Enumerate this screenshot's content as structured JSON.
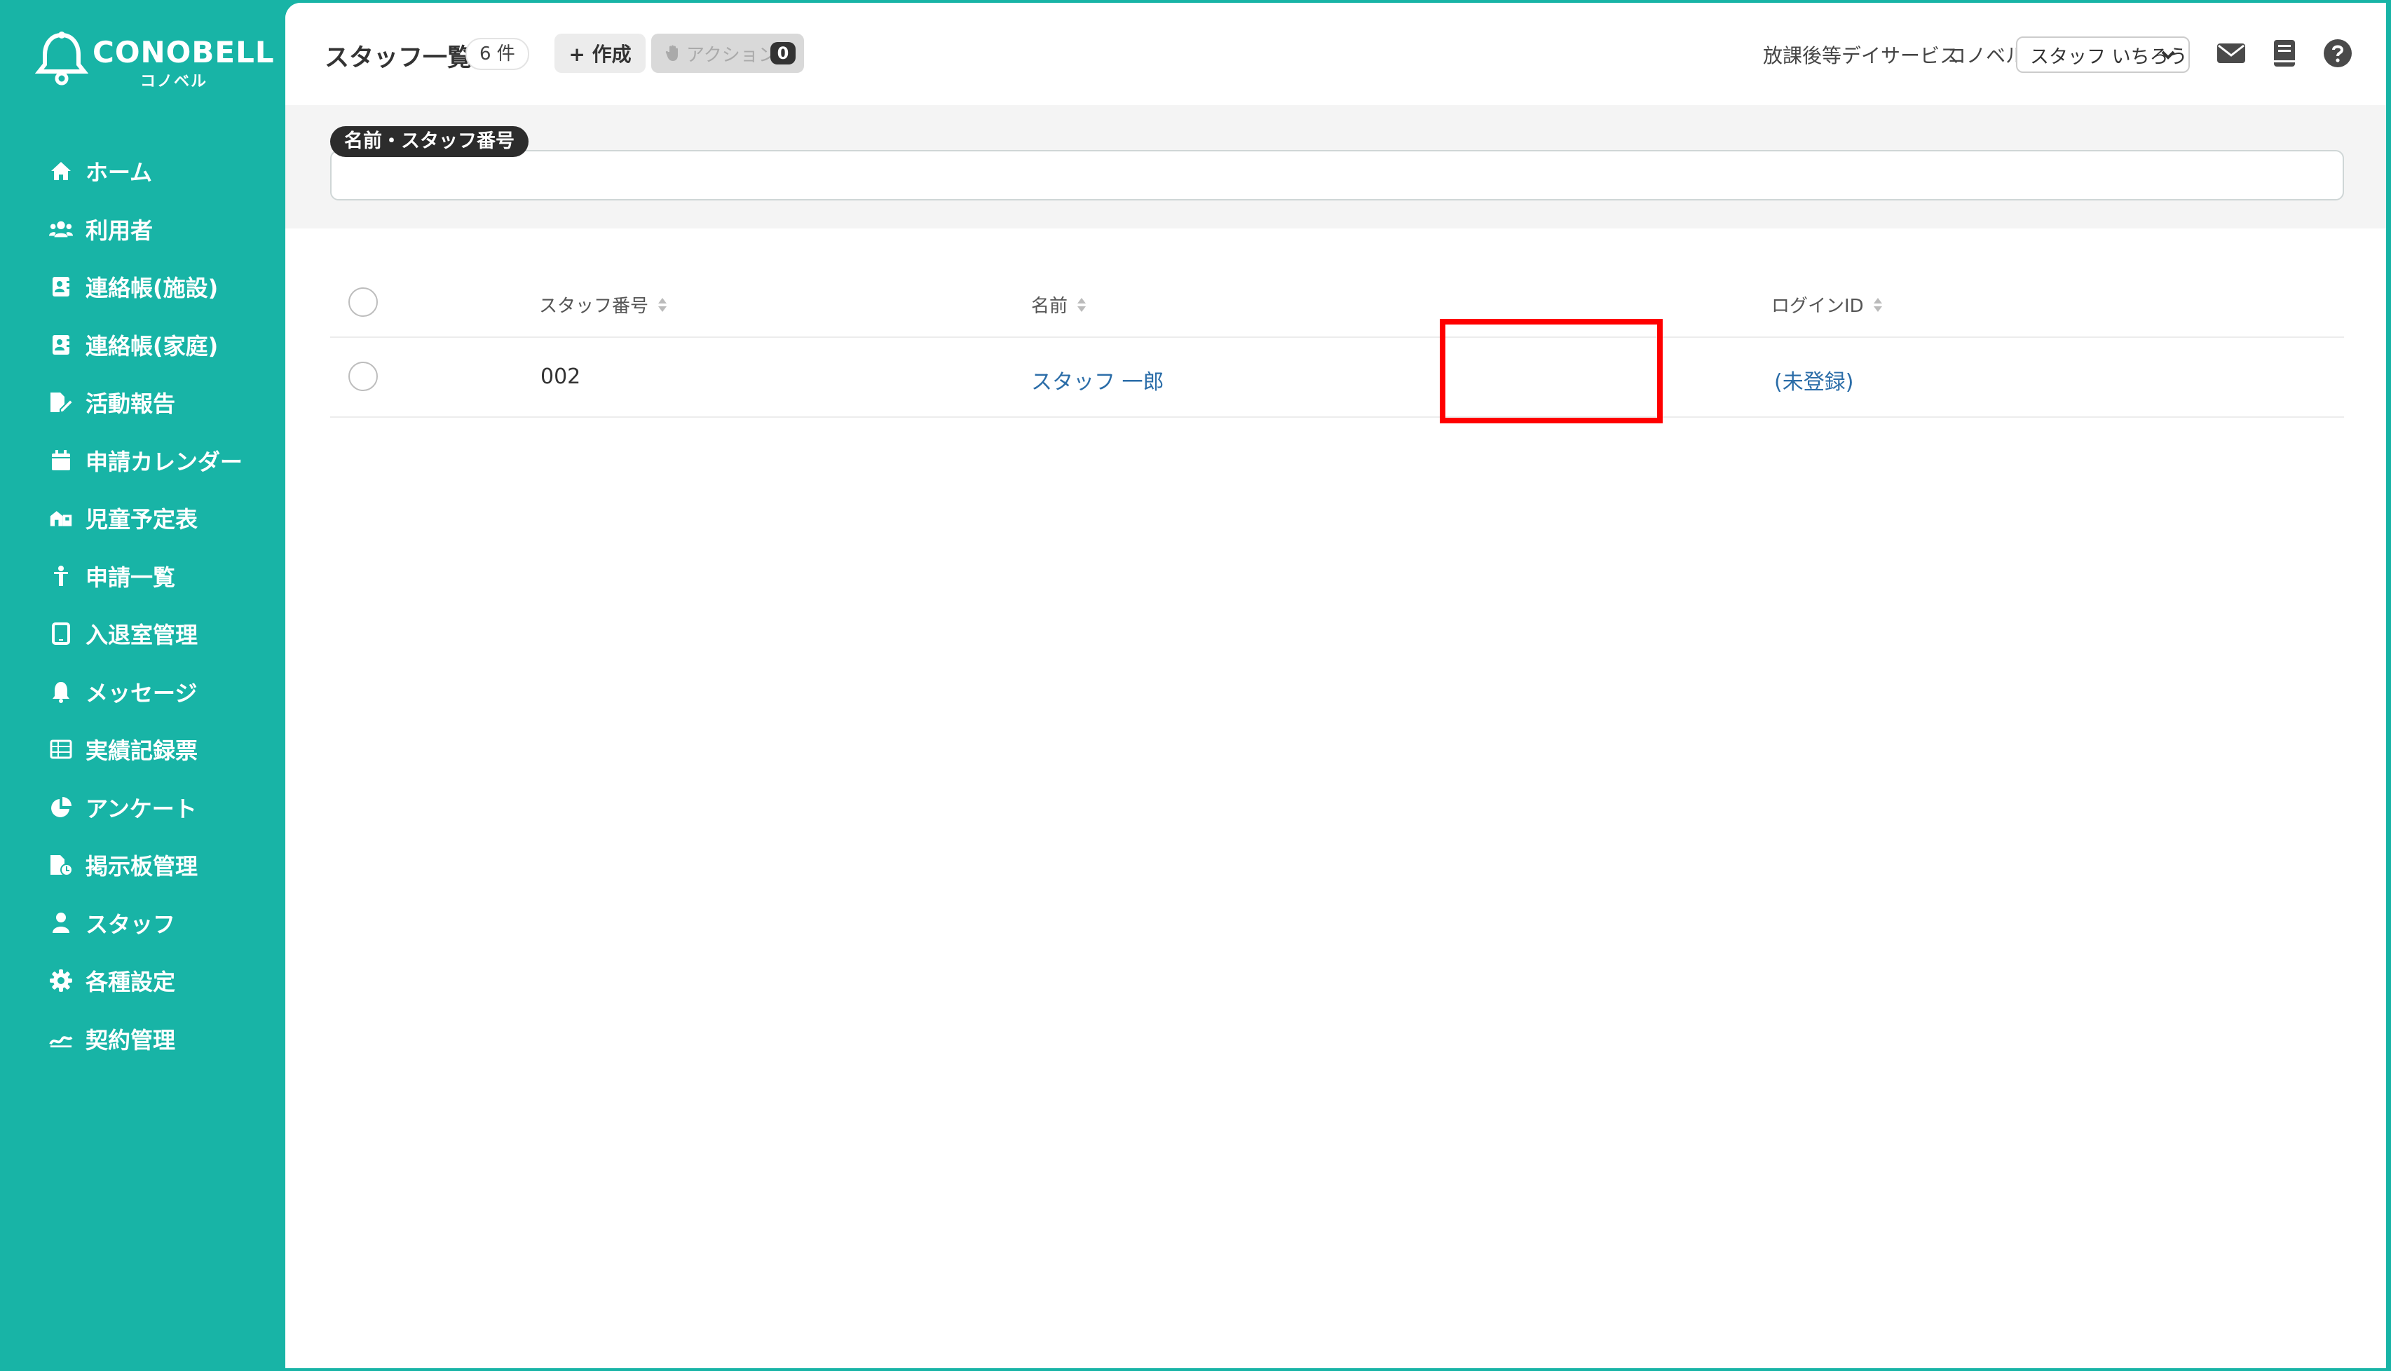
{
  "colors": {
    "brand": "#18b4a6",
    "highlight": "#ff0000",
    "link": "#2b6da8",
    "badge": "#333333"
  },
  "logo": {
    "brand": "CONOBELL",
    "sub": "コノベル"
  },
  "sidebar": {
    "items": [
      {
        "label": "ホーム",
        "icon": "home-icon"
      },
      {
        "label": "利用者",
        "icon": "users-icon"
      },
      {
        "label": "連絡帳(施設)",
        "icon": "contact-book-icon"
      },
      {
        "label": "連絡帳(家庭)",
        "icon": "contact-book-icon"
      },
      {
        "label": "活動報告",
        "icon": "report-edit-icon"
      },
      {
        "label": "申請カレンダー",
        "icon": "calendar-icon"
      },
      {
        "label": "児童予定表",
        "icon": "schedule-icon"
      },
      {
        "label": "申請一覧",
        "icon": "child-icon"
      },
      {
        "label": "入退室管理",
        "icon": "tablet-icon"
      },
      {
        "label": "メッセージ",
        "icon": "bell-icon"
      },
      {
        "label": "実績記録票",
        "icon": "table-icon"
      },
      {
        "label": "アンケート",
        "icon": "pie-chart-icon"
      },
      {
        "label": "掲示板管理",
        "icon": "board-file-icon"
      },
      {
        "label": "スタッフ",
        "icon": "staff-icon"
      },
      {
        "label": "各種設定",
        "icon": "gear-icon"
      },
      {
        "label": "契約管理",
        "icon": "contract-icon"
      }
    ]
  },
  "header": {
    "title": "スタッフ一覧",
    "count": "6 件",
    "create_label": "+ 作成",
    "action_label": "アクション",
    "action_count": "0",
    "facility": "放課後等デイサービス",
    "company": "コノベル",
    "user": "スタッフ いちろう"
  },
  "filter": {
    "label": "名前・スタッフ番号",
    "value": ""
  },
  "table": {
    "columns": [
      "スタッフ番号",
      "名前",
      "ログインID"
    ],
    "rows": [
      {
        "number": "002",
        "name": "スタッフ 一郎",
        "login_id": "(未登録)"
      }
    ]
  }
}
